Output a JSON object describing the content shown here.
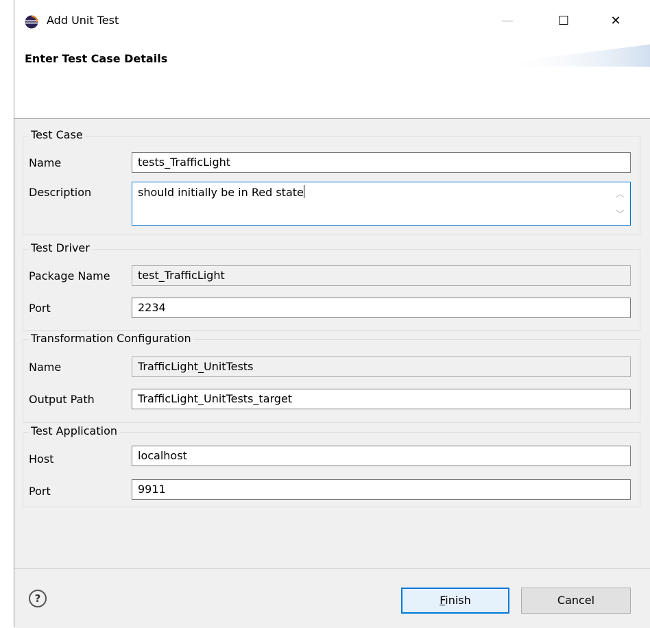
{
  "window": {
    "title": "Add Unit Test",
    "minimize_glyph": "—",
    "maximize_glyph": "☐",
    "close_glyph": "✕"
  },
  "banner": {
    "title": "Enter Test Case Details"
  },
  "test_case": {
    "legend": "Test Case",
    "name_label": "Name",
    "name_value": "tests_TrafficLight",
    "description_label": "Description",
    "description_value": "should initially be in Red state"
  },
  "test_driver": {
    "legend": "Test Driver",
    "package_label": "Package Name",
    "package_value": "test_TrafficLight",
    "port_label": "Port",
    "port_value": "2234"
  },
  "transformation": {
    "legend": "Transformation Configuration",
    "name_label": "Name",
    "name_value": "TrafficLight_UnitTests",
    "output_label": "Output Path",
    "output_value": "TrafficLight_UnitTests_target"
  },
  "test_application": {
    "legend": "Test Application",
    "host_label": "Host",
    "host_value": "localhost",
    "port_label": "Port",
    "port_value": "9911"
  },
  "footer": {
    "help_glyph": "?",
    "finish_mnemonic": "F",
    "finish_rest": "inish",
    "cancel_label": "Cancel"
  },
  "colors": {
    "accent": "#0078d7",
    "dialog_bg": "#f0f0f0"
  },
  "icons": [
    "eclipse-app-icon",
    "help-icon",
    "scroll-up-icon",
    "scroll-down-icon"
  ]
}
